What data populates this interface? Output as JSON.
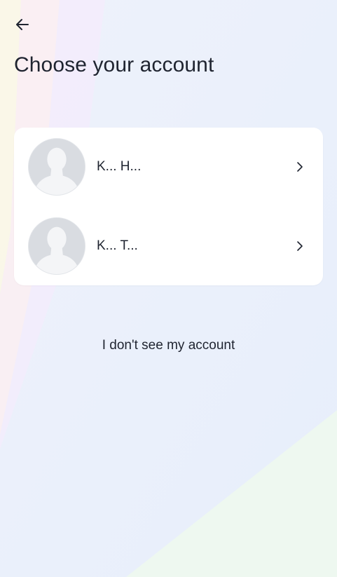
{
  "header": {
    "back_icon": "arrow-left-icon",
    "title": "Choose your account"
  },
  "accounts": [
    {
      "name": "K... H...",
      "avatar_icon": "default-avatar-icon",
      "chevron_icon": "chevron-right-icon"
    },
    {
      "name": "K... T...",
      "avatar_icon": "default-avatar-icon",
      "chevron_icon": "chevron-right-icon"
    }
  ],
  "footer": {
    "no_account_label": "I don't see my account"
  },
  "colors": {
    "background": "#eaf1fb",
    "card": "#ffffff",
    "text": "#1f2430",
    "avatar_bg": "#d9dce1",
    "avatar_silhouette": "#f4f5f7"
  }
}
